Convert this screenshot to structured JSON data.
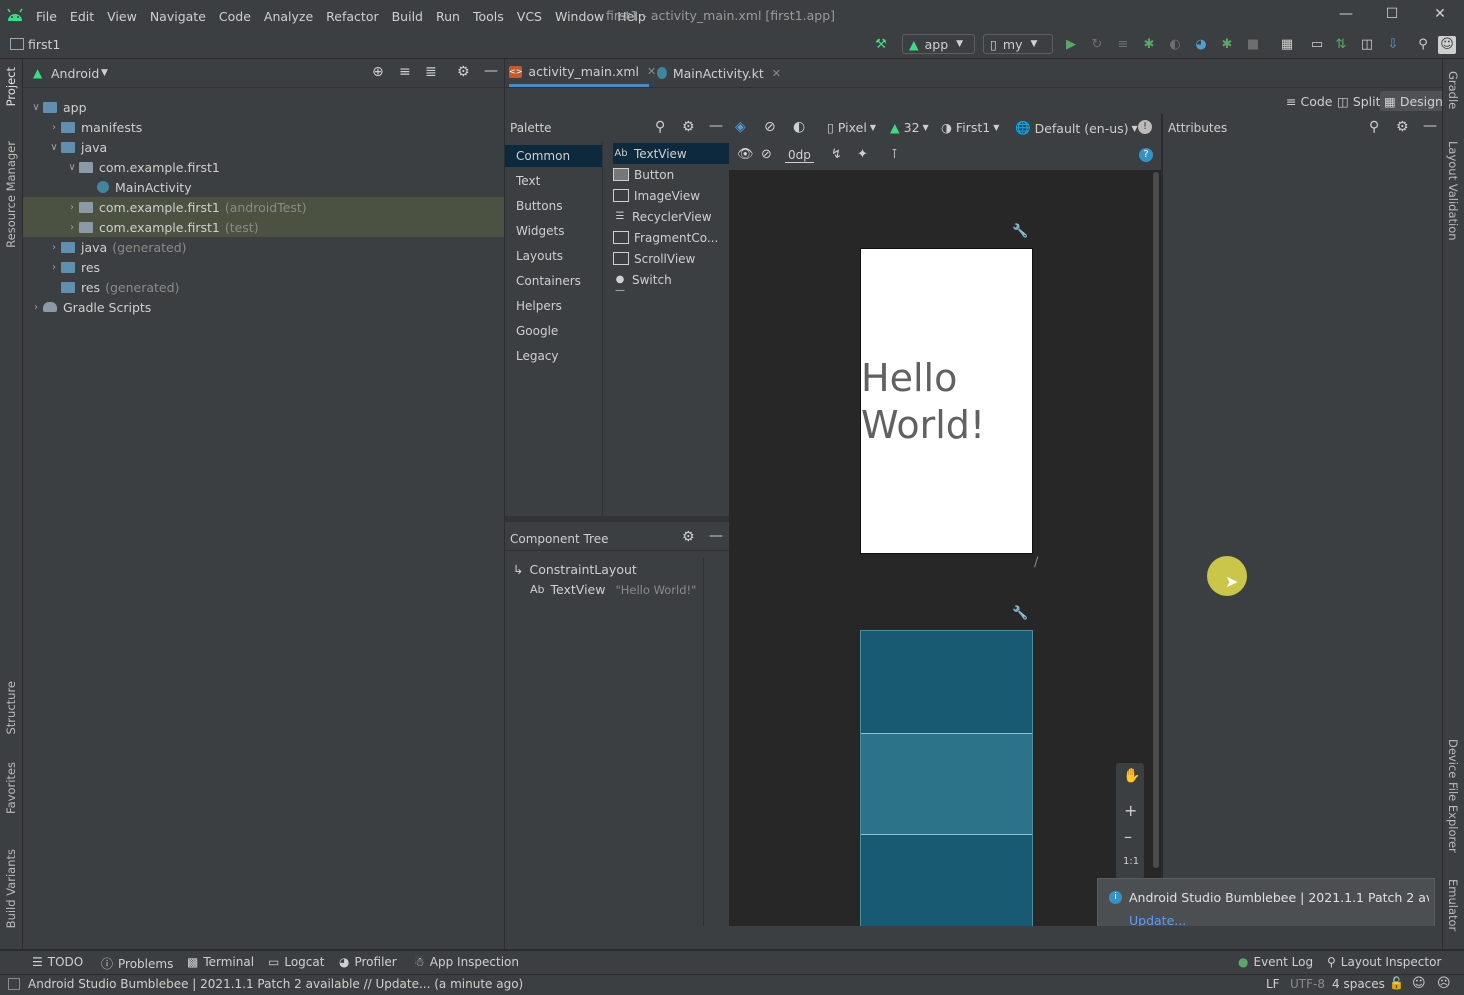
{
  "menubar": {
    "menus": [
      "File",
      "Edit",
      "View",
      "Navigate",
      "Code",
      "Analyze",
      "Refactor",
      "Build",
      "Run",
      "Tools",
      "VCS",
      "Window",
      "Help"
    ],
    "window_title": "first1 - activity_main.xml [first1.app]"
  },
  "navbar": {
    "project": "first1",
    "run_config": "app",
    "device": "my"
  },
  "left_stripe": {
    "tabs": [
      "Project",
      "Resource Manager",
      "Structure",
      "Favorites",
      "Build Variants"
    ]
  },
  "right_stripe": {
    "tabs": [
      "Gradle",
      "Layout Validation",
      "Device File Explorer",
      "Emulator"
    ]
  },
  "project_panel": {
    "view_mode": "Android",
    "tree": [
      {
        "label": "app",
        "sub": "",
        "level": 0,
        "arrow": "v",
        "highlight": false,
        "icon": "module-folder-icon"
      },
      {
        "label": "manifests",
        "sub": "",
        "level": 1,
        "arrow": ">",
        "highlight": false,
        "icon": "folder-icon"
      },
      {
        "label": "java",
        "sub": "",
        "level": 1,
        "arrow": "v",
        "highlight": false,
        "icon": "folder-icon"
      },
      {
        "label": "com.example.first1",
        "sub": "",
        "level": 2,
        "arrow": "v",
        "highlight": false,
        "icon": "package-icon"
      },
      {
        "label": "MainActivity",
        "sub": "",
        "level": 3,
        "arrow": "",
        "highlight": false,
        "icon": "kotlin-class-icon"
      },
      {
        "label": "com.example.first1",
        "sub": "(androidTest)",
        "level": 2,
        "arrow": ">",
        "highlight": true,
        "icon": "package-icon"
      },
      {
        "label": "com.example.first1",
        "sub": "(test)",
        "level": 2,
        "arrow": ">",
        "highlight": true,
        "icon": "package-icon"
      },
      {
        "label": "java",
        "sub": "(generated)",
        "level": 1,
        "arrow": ">",
        "highlight": false,
        "icon": "folder-icon"
      },
      {
        "label": "res",
        "sub": "",
        "level": 1,
        "arrow": ">",
        "highlight": false,
        "icon": "folder-icon"
      },
      {
        "label": "res",
        "sub": "(generated)",
        "level": 1,
        "arrow": "",
        "highlight": false,
        "icon": "folder-icon"
      },
      {
        "label": "Gradle Scripts",
        "sub": "",
        "level": 0,
        "arrow": ">",
        "highlight": false,
        "icon": "gradle-icon"
      }
    ]
  },
  "editor": {
    "tabs": [
      {
        "label": "activity_main.xml",
        "active": true
      },
      {
        "label": "MainActivity.kt",
        "active": false
      }
    ],
    "modes": {
      "code": "Code",
      "split": "Split",
      "design": "Design"
    }
  },
  "palette": {
    "title": "Palette",
    "categories": [
      "Common",
      "Text",
      "Buttons",
      "Widgets",
      "Layouts",
      "Containers",
      "Helpers",
      "Google",
      "Legacy"
    ],
    "items": [
      "TextView",
      "Button",
      "ImageView",
      "RecyclerView",
      "FragmentCo...",
      "ScrollView",
      "Switch"
    ]
  },
  "component_tree": {
    "title": "Component Tree",
    "root": "ConstraintLayout",
    "child_label": "TextView",
    "child_text": "\"Hello World!\""
  },
  "design_toolbar": {
    "device": "Pixel",
    "api": "32",
    "theme": "First1",
    "locale": "Default (en-us)",
    "margin": "0dp"
  },
  "design_surface": {
    "preview_text_line1": "Hello",
    "preview_text_line2": "World!",
    "zoom_fit": "1:1"
  },
  "attributes": {
    "title": "Attributes"
  },
  "notification": {
    "title": "Android Studio Bumblebee | 2021.1.1 Patch 2 av",
    "action": "Update..."
  },
  "bottom_tabs": {
    "left": [
      "TODO",
      "Problems",
      "Terminal",
      "Logcat",
      "Profiler",
      "App Inspection"
    ],
    "right": [
      "Event Log",
      "Layout Inspector"
    ]
  },
  "status_bar": {
    "message": "Android Studio Bumblebee | 2021.1.1 Patch 2 available // Update... (a minute ago)",
    "line_sep": "LF",
    "encoding": "UTF-8",
    "indent": "4 spaces"
  },
  "colors": {
    "accent_green": "#3ddc84",
    "selection_blue": "#0d293e",
    "highlight_olive": "#4b5241",
    "blueprint": "#175a72"
  }
}
